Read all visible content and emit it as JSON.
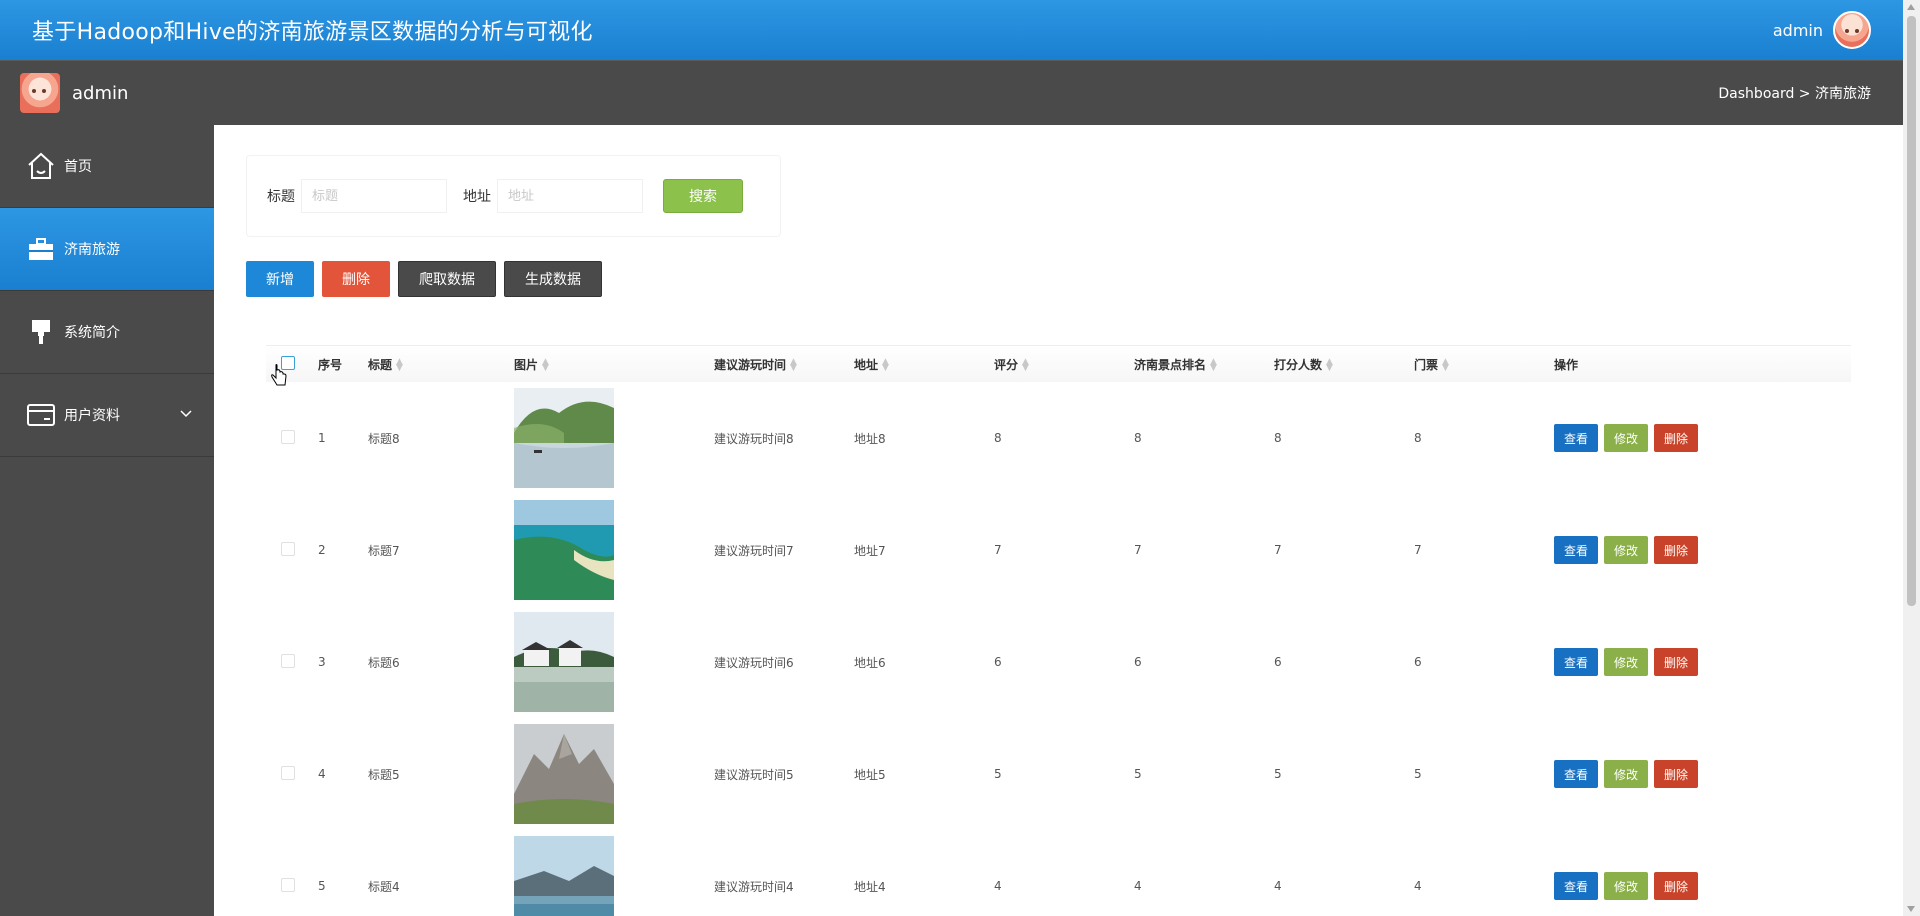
{
  "header": {
    "title": "基于Hadoop和Hive的济南旅游景区数据的分析与可视化",
    "username": "admin"
  },
  "subheader": {
    "username": "admin",
    "breadcrumb": "Dashboard > 济南旅游"
  },
  "sidebar": {
    "items": [
      {
        "label": "首页",
        "icon": "home-icon",
        "active": false
      },
      {
        "label": "济南旅游",
        "icon": "briefcase-icon",
        "active": true
      },
      {
        "label": "系统简介",
        "icon": "brush-icon",
        "active": false
      },
      {
        "label": "用户资料",
        "icon": "card-icon",
        "active": false
      }
    ]
  },
  "search": {
    "title_label": "标题",
    "title_placeholder": "标题",
    "address_label": "地址",
    "address_placeholder": "地址",
    "button": "搜索"
  },
  "actions": {
    "add": "新增",
    "delete": "删除",
    "crawl": "爬取数据",
    "generate": "生成数据"
  },
  "table": {
    "headers": {
      "index": "序号",
      "title": "标题",
      "image": "图片",
      "time": "建议游玩时间",
      "address": "地址",
      "score": "评分",
      "rank": "济南景点排名",
      "raters": "打分人数",
      "ticket": "门票",
      "ops": "操作"
    },
    "op_labels": {
      "view": "查看",
      "edit": "修改",
      "delete": "删除"
    },
    "rows": [
      {
        "index": "1",
        "title": "标题8",
        "time": "建议游玩时间8",
        "address": "地址8",
        "score": "8",
        "rank": "8",
        "raters": "8",
        "ticket": "8"
      },
      {
        "index": "2",
        "title": "标题7",
        "time": "建议游玩时间7",
        "address": "地址7",
        "score": "7",
        "rank": "7",
        "raters": "7",
        "ticket": "7"
      },
      {
        "index": "3",
        "title": "标题6",
        "time": "建议游玩时间6",
        "address": "地址6",
        "score": "6",
        "rank": "6",
        "raters": "6",
        "ticket": "6"
      },
      {
        "index": "4",
        "title": "标题5",
        "time": "建议游玩时间5",
        "address": "地址5",
        "score": "5",
        "rank": "5",
        "raters": "5",
        "ticket": "5"
      },
      {
        "index": "5",
        "title": "标题4",
        "time": "建议游玩时间4",
        "address": "地址4",
        "score": "4",
        "rank": "4",
        "raters": "4",
        "ticket": "4"
      }
    ]
  },
  "colors": {
    "primary": "#1e88d8",
    "danger": "#e2553b",
    "success": "#8cc14c",
    "sidebar": "#4a4a4a"
  }
}
